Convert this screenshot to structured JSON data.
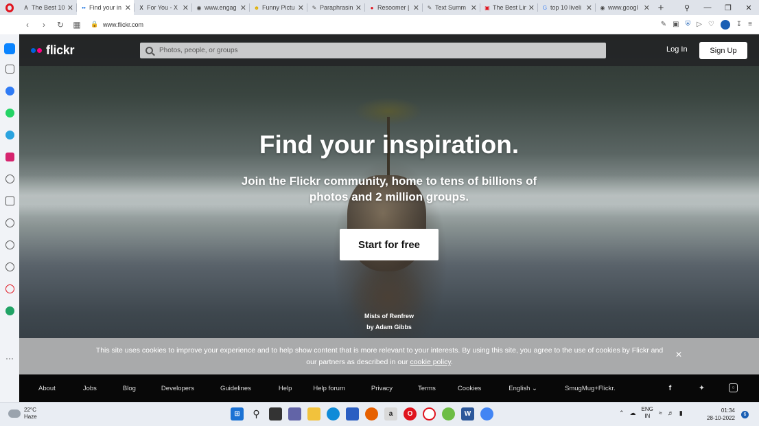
{
  "browser": {
    "tabs": [
      {
        "title": "The Best 10",
        "favicon": "A",
        "color": "#222222"
      },
      {
        "title": "Find your in",
        "favicon": "••",
        "color": "#0063dc",
        "active": true
      },
      {
        "title": "For You - X",
        "favicon": "X",
        "color": "#000000"
      },
      {
        "title": "www.engag",
        "favicon": "◉",
        "color": "#444444"
      },
      {
        "title": "Funny Pictu",
        "favicon": "☻",
        "color": "#e0b000"
      },
      {
        "title": "Paraphrasin",
        "favicon": "✎",
        "color": "#555555"
      },
      {
        "title": "Resoomer |",
        "favicon": "●",
        "color": "#e0141e"
      },
      {
        "title": "Text Summ",
        "favicon": "✎",
        "color": "#555555"
      },
      {
        "title": "The Best Lin",
        "favicon": "▣",
        "color": "#e0141e"
      },
      {
        "title": "top 10 liveli",
        "favicon": "G",
        "color": "#4285f4"
      },
      {
        "title": "www.googl",
        "favicon": "◉",
        "color": "#444444"
      }
    ],
    "new_tab_label": "+",
    "url": "www.flickr.com"
  },
  "flickr": {
    "logo_text": "flickr",
    "search_placeholder": "Photos, people, or groups",
    "login_label": "Log In",
    "signup_label": "Sign Up",
    "headline": "Find your inspiration.",
    "subline": "Join the Flickr community, home to tens of billions of photos and 2 million groups.",
    "cta_label": "Start for free",
    "photo_title": "Mists of Renfrew",
    "photo_author": "by Adam Gibbs",
    "cookie_text": "This site uses cookies to improve your experience and to help show content that is more relevant to your interests. By using this site, you agree to the use of cookies by Flickr and our partners as described in our",
    "cookie_link": "cookie policy",
    "cookie_period": ".",
    "cookie_close": "×",
    "footer_links": [
      "About",
      "Jobs",
      "Blog",
      "Developers",
      "Guidelines",
      "Help",
      "Help forum",
      "Privacy",
      "Terms",
      "Cookies",
      "English ⌄",
      "SmugMug+Flickr."
    ],
    "brand_colors": {
      "blue": "#0063dc",
      "pink": "#ff0084"
    }
  },
  "taskbar": {
    "temperature": "22°C",
    "weather": "Haze",
    "lang_line1": "ENG",
    "lang_line2": "IN",
    "time": "01:34",
    "date": "28-10-2022",
    "notifications": "6"
  }
}
